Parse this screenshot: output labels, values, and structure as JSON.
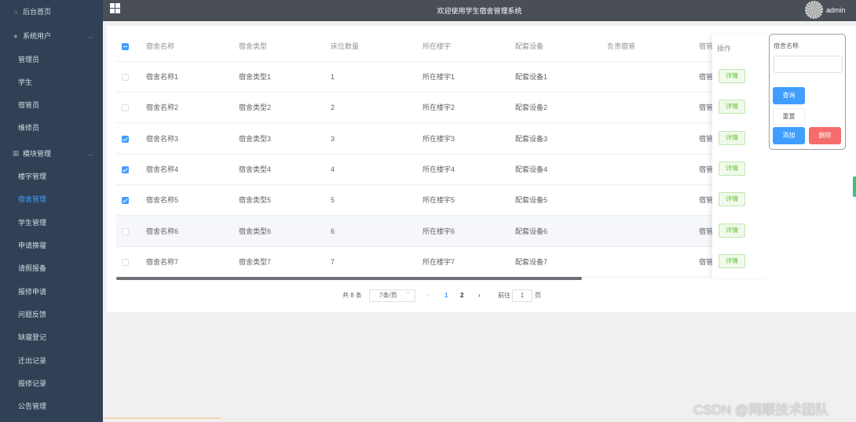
{
  "sidebar": {
    "home": "后台首页",
    "group_users": "系统用户",
    "users": [
      "管理员",
      "学生",
      "宿管员",
      "维修员"
    ],
    "group_modules": "模块管理",
    "modules": [
      "楼宇管理",
      "宿舍管理",
      "学生管理",
      "申请换寝",
      "请假报备",
      "报修申请",
      "问题反馈",
      "缺寝登记",
      "迁出记录",
      "报修记录",
      "公告管理"
    ],
    "active_module": "宿舍管理"
  },
  "header": {
    "title": "欢迎使用学生宿舍管理系统",
    "user": "admin"
  },
  "table": {
    "columns": [
      "宿舍名称",
      "宿舍类型",
      "床位数量",
      "所在楼宇",
      "配套设备",
      "负责宿管",
      "宿管"
    ],
    "op_column": "操作",
    "detail_label": "详情",
    "rows": [
      {
        "name": "宿舍名称1",
        "type": "宿舍类型1",
        "beds": "1",
        "building": "所在楼宇1",
        "equip": "配套设备1",
        "keeper": "",
        "keeper2": "宿管",
        "checked": false
      },
      {
        "name": "宿舍名称2",
        "type": "宿舍类型2",
        "beds": "2",
        "building": "所在楼宇2",
        "equip": "配套设备2",
        "keeper": "",
        "keeper2": "宿管",
        "checked": false
      },
      {
        "name": "宿舍名称3",
        "type": "宿舍类型3",
        "beds": "3",
        "building": "所在楼宇3",
        "equip": "配套设备3",
        "keeper": "",
        "keeper2": "宿管",
        "checked": true
      },
      {
        "name": "宿舍名称4",
        "type": "宿舍类型4",
        "beds": "4",
        "building": "所在楼宇4",
        "equip": "配套设备4",
        "keeper": "",
        "keeper2": "宿管",
        "checked": true
      },
      {
        "name": "宿舍名称5",
        "type": "宿舍类型5",
        "beds": "5",
        "building": "所在楼宇5",
        "equip": "配套设备5",
        "keeper": "",
        "keeper2": "宿管",
        "checked": true
      },
      {
        "name": "宿舍名称6",
        "type": "宿舍类型6",
        "beds": "6",
        "building": "所在楼宇6",
        "equip": "配套设备6",
        "keeper": "",
        "keeper2": "宿管",
        "checked": false
      },
      {
        "name": "宿舍名称7",
        "type": "宿舍类型7",
        "beds": "7",
        "building": "所在楼宇7",
        "equip": "配套设备7",
        "keeper": "",
        "keeper2": "宿管",
        "checked": false
      }
    ]
  },
  "pagination": {
    "total": "共 8 条",
    "page_size": "7条/页",
    "prev": "‹",
    "pages": [
      "1",
      "2"
    ],
    "next": "›",
    "goto": "前往",
    "goto_value": "1",
    "page_suffix": "页"
  },
  "search": {
    "label": "宿舍名称",
    "value": "",
    "query": "查询",
    "reset": "重置",
    "add": "添加",
    "delete": "删除"
  },
  "watermark": "CSDN @网顺技术团队",
  "colors": {
    "sidebar_bg": "#304156",
    "header_bg": "#4a4f57",
    "primary": "#409eff",
    "danger": "#f56c6c",
    "success": "#67c23a"
  }
}
